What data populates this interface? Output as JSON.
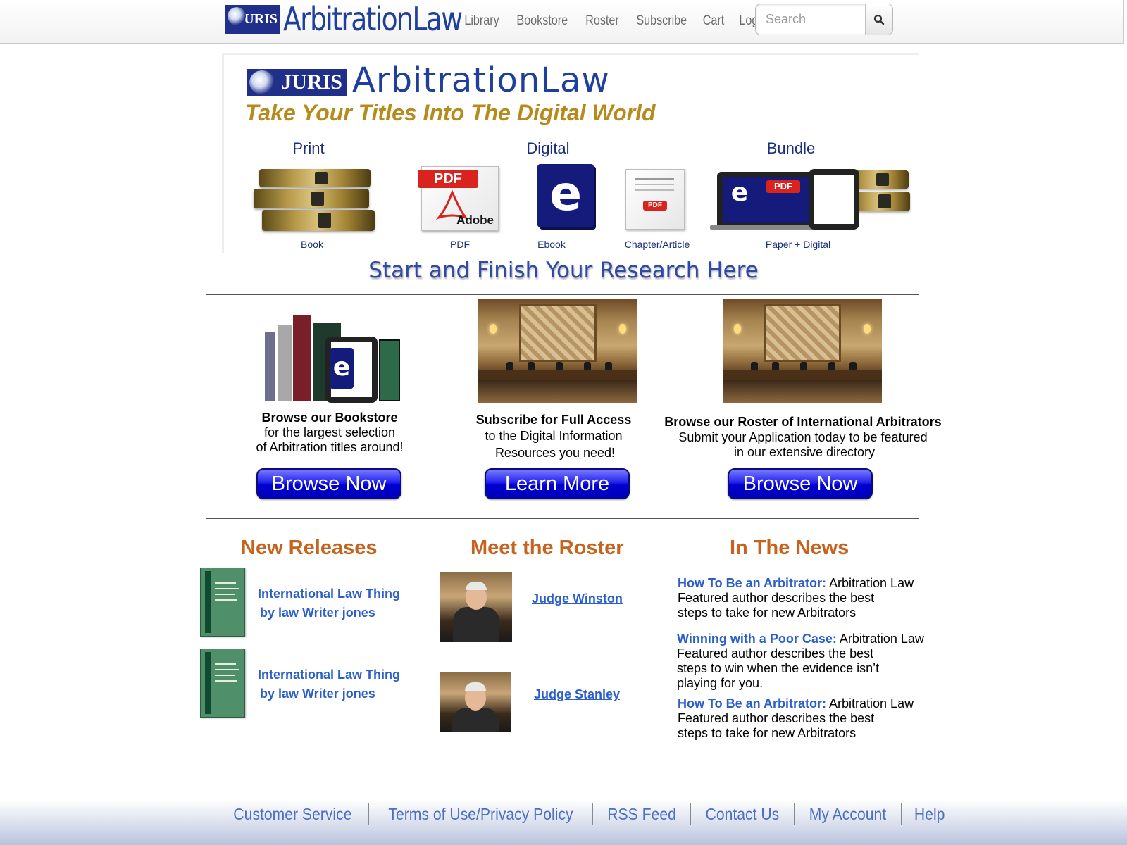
{
  "header": {
    "logo_badge": "JURIS",
    "logo_text": "ArbitrationLaw",
    "nav": [
      "Library",
      "Bookstore",
      "Roster",
      "Subscribe",
      "Cart",
      "Logout"
    ],
    "search_placeholder": "Search"
  },
  "banner": {
    "logo_badge": "JURIS",
    "logo_text": "ArbitrationLaw",
    "tagline": "Take Your Titles Into The Digital World",
    "headings": {
      "print": "Print",
      "digital": "Digital",
      "bundle": "Bundle"
    },
    "labels": {
      "book": "Book",
      "pdf": "PDF",
      "ebook": "Ebook",
      "chapter": "Chapter/Article",
      "bundle": "Paper + Digital"
    },
    "pdf_tag": "PDF",
    "adobe": "Adobe",
    "ebook_letter": "e"
  },
  "research_heading": "Start and Finish Your Research Here",
  "features": [
    {
      "title": "Browse our Bookstore",
      "lines": [
        "for the largest selection",
        "of Arbitration titles around!"
      ],
      "button": "Browse Now"
    },
    {
      "title": "Subscribe for Full Access",
      "lines": [
        "to the Digital Information",
        "Resources you need!"
      ],
      "button": "Learn More"
    },
    {
      "title": "Browse our Roster of International Arbitrators",
      "lines": [
        "Submit your Application today to be featured",
        "in our extensive directory"
      ],
      "button": "Browse Now"
    }
  ],
  "new_releases": {
    "heading": "New Releases",
    "items": [
      {
        "line1": "International Law Thing",
        "line2": "by law Writer jones"
      },
      {
        "line1": "International Law Thing",
        "line2": "by law Writer jones"
      }
    ]
  },
  "roster": {
    "heading": "Meet the Roster",
    "items": [
      {
        "name": "Judge Winston"
      },
      {
        "name": "Judge Stanley"
      }
    ]
  },
  "news": {
    "heading": "In The News",
    "items": [
      {
        "title": "How To Be an Arbitrator:",
        "lines": [
          "Arbitration Law",
          "Featured author describes the best",
          "steps to take for new Arbitrators"
        ]
      },
      {
        "title": "Winning with a Poor Case:",
        "lines": [
          "Arbitration Law",
          "Featured author describes the best",
          "steps to win when the evidence isn’t",
          "playing for you."
        ]
      },
      {
        "title": "How To Be an Arbitrator:",
        "lines": [
          "Arbitration Law",
          "Featured author describes the best",
          "steps to take for new Arbitrators"
        ]
      }
    ]
  },
  "footer": {
    "links": [
      "Customer Service",
      "Terms of Use/Privacy Policy",
      "RSS Feed",
      "Contact Us",
      "My Account",
      "Help"
    ]
  },
  "colors": {
    "brand_blue": "#1f3f9c",
    "tagline_gold": "#b78a1c",
    "section_orange": "#c4641f",
    "link_blue": "#2a5ecb",
    "cta_blue": "#0000d0"
  },
  "icons": {
    "search_button": "magnifier-icon"
  }
}
